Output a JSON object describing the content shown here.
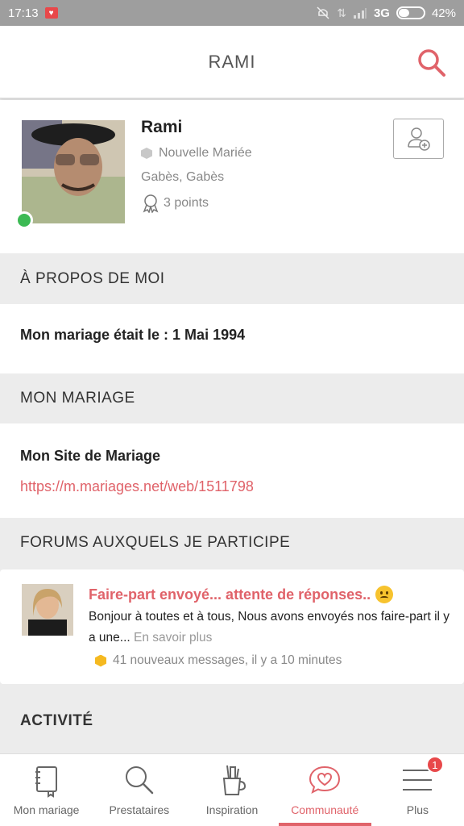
{
  "status_bar": {
    "time": "17:13",
    "network": "3G",
    "battery": "42%",
    "battery_level": 0.42
  },
  "header": {
    "title": "RAMI"
  },
  "profile": {
    "name": "Rami",
    "status": "Nouvelle Mariée",
    "location": "Gabès, Gabès",
    "points": "3 points"
  },
  "about": {
    "heading": "À PROPOS DE MOI",
    "wedding_date_label": "Mon mariage était le : ",
    "wedding_date": "1 Mai 1994"
  },
  "wedding": {
    "heading": "MON MARIAGE",
    "site_label": "Mon Site de Mariage",
    "site_url": "https://m.mariages.net/web/1511798"
  },
  "forums": {
    "heading": "FORUMS AUXQUELS JE PARTICIPE",
    "items": [
      {
        "title": "Faire-part envoyé... attente de réponses..",
        "excerpt": "Bonjour à toutes et à tous, Nous avons envoyés nos faire-part il y a une...",
        "read_more": "En savoir plus",
        "meta": "41 nouveaux messages, il y a 10 minutes"
      }
    ]
  },
  "activity": {
    "heading": "ACTIVITÉ"
  },
  "bottom_nav": {
    "items": [
      {
        "label": "Mon mariage",
        "icon": "notebook-icon"
      },
      {
        "label": "Prestataires",
        "icon": "search-icon"
      },
      {
        "label": "Inspiration",
        "icon": "inspiration-cup-icon"
      },
      {
        "label": "Communauté",
        "icon": "heart-chat-icon",
        "active": true
      },
      {
        "label": "Plus",
        "icon": "menu-icon",
        "badge": "1"
      }
    ]
  },
  "colors": {
    "accent": "#e0636a",
    "online": "#3cba54",
    "badge": "#e8484a"
  }
}
